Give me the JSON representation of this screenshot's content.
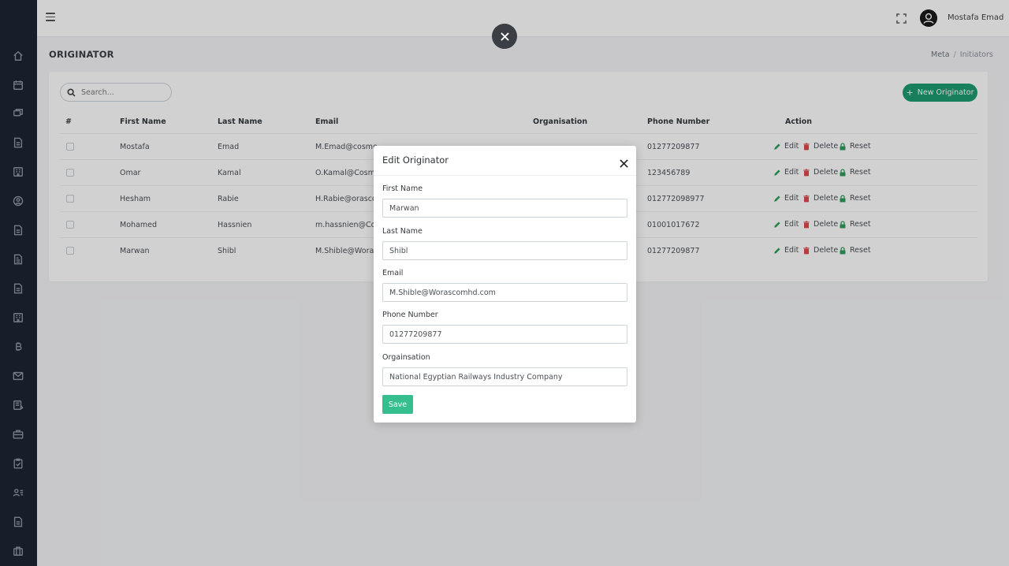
{
  "topbar": {
    "user_name": "Mostafa Emad"
  },
  "page": {
    "title": "ORIGINATOR",
    "breadcrumb": [
      "Meta",
      "Initiators"
    ]
  },
  "toolbar": {
    "search_placeholder": "Search...",
    "new_button": "New Originator"
  },
  "table": {
    "headers": [
      "#",
      "First Name",
      "Last Name",
      "Email",
      "Organisation",
      "Phone Number",
      "Action"
    ],
    "rows": [
      {
        "first": "Mostafa",
        "last": "Emad",
        "email": "M.Emad@cosmo",
        "org": "",
        "phone": "01277209877"
      },
      {
        "first": "Omar",
        "last": "Kamal",
        "email": "O.Kamal@Cosmo",
        "org": "",
        "phone": "123456789"
      },
      {
        "first": "Hesham",
        "last": "Rabie",
        "email": "H.Rabie@orasco",
        "org": "",
        "phone": "012772098977"
      },
      {
        "first": "Mohamed",
        "last": "Hassnien",
        "email": "m.hassnien@Co",
        "org": "",
        "phone": "01001017672"
      },
      {
        "first": "Marwan",
        "last": "Shibl",
        "email": "M.Shible@Woras",
        "org": "",
        "phone": "01277209877"
      }
    ],
    "actions": {
      "edit": "Edit",
      "delete": "Delete",
      "reset": "Reset"
    }
  },
  "modal": {
    "title": "Edit Originator",
    "fields": [
      {
        "label": "First Name",
        "value": "Marwan"
      },
      {
        "label": "Last Name",
        "value": "Shibl"
      },
      {
        "label": "Email",
        "value": "M.Shible@Worascomhd.com"
      },
      {
        "label": "Phone Number",
        "value": "01277209877"
      },
      {
        "label": "Orgainsation",
        "value": "National Egyptian Railways Industry Company"
      }
    ],
    "save_label": "Save"
  },
  "colors": {
    "sidebar": "#1d2433",
    "primary_green": "#1e9b71",
    "save_green": "#35bf8f",
    "edit_icon": "#2e9e5b",
    "delete_icon": "#e0474c",
    "reset_icon": "#2e9e5b"
  }
}
